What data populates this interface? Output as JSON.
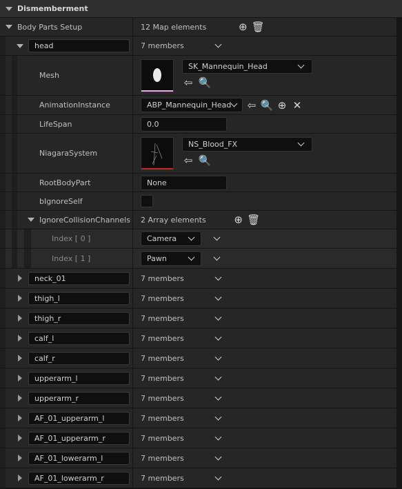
{
  "section": {
    "title": "Dismemberment"
  },
  "body_parts": {
    "label": "Body Parts Setup",
    "count": "12 Map elements"
  },
  "head": {
    "key": "head",
    "members": "7 members",
    "mesh": {
      "label": "Mesh",
      "value": "SK_Mannequin_Head",
      "accent": "#e8a8e8"
    },
    "anim": {
      "label": "AnimationInstance",
      "value": "ABP_Mannequin_Head"
    },
    "lifespan": {
      "label": "LifeSpan",
      "value": "0.0"
    },
    "niagara": {
      "label": "NiagaraSystem",
      "value": "NS_Blood_FX",
      "accent": "#c42020"
    },
    "root": {
      "label": "RootBodyPart",
      "value": "None"
    },
    "ignore_self": {
      "label": "bIgnoreSelf",
      "checked": false
    },
    "channels": {
      "label": "IgnoreCollisionChannels",
      "count": "2 Array elements",
      "items": [
        {
          "index": "Index [ 0 ]",
          "value": "Camera"
        },
        {
          "index": "Index [ 1 ]",
          "value": "Pawn"
        }
      ]
    }
  },
  "collapsed": [
    {
      "key": "neck_01",
      "members": "7 members"
    },
    {
      "key": "thigh_l",
      "members": "7 members"
    },
    {
      "key": "thigh_r",
      "members": "7 members"
    },
    {
      "key": "calf_l",
      "members": "7 members"
    },
    {
      "key": "calf_r",
      "members": "7 members"
    },
    {
      "key": "upperarm_l",
      "members": "7 members"
    },
    {
      "key": "upperarm_r",
      "members": "7 members"
    },
    {
      "key": "AF_01_upperarm_l",
      "members": "7 members"
    },
    {
      "key": "AF_01_upperarm_r",
      "members": "7 members"
    },
    {
      "key": "AF_01_lowerarm_l",
      "members": "7 members"
    },
    {
      "key": "AF_01_lowerarm_r",
      "members": "7 members"
    }
  ]
}
